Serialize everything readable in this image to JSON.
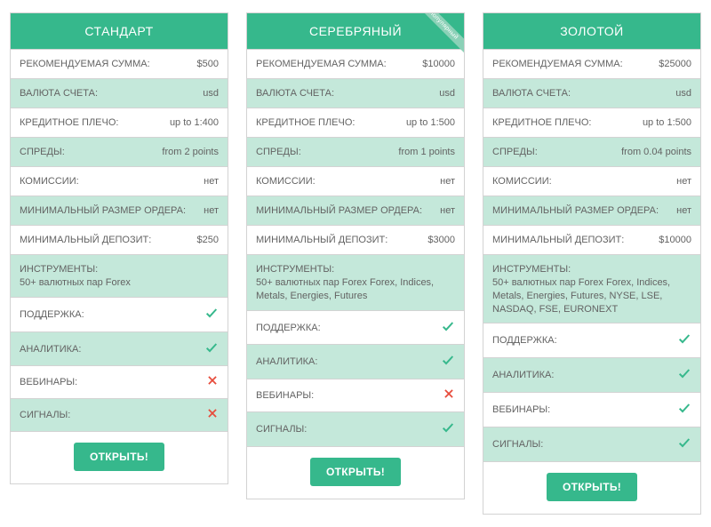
{
  "ribbon_label": "популярный",
  "open_label": "ОТКРЫТЬ!",
  "labels": {
    "amount": "РЕКОМЕНДУЕМАЯ СУММА:",
    "currency": "ВАЛЮТА СЧЕТА:",
    "leverage": "КРЕДИТНОЕ ПЛЕЧО:",
    "spreads": "СПРЕДЫ:",
    "commission": "КОМИССИИ:",
    "min_order": "МИНИМАЛЬНЫЙ РАЗМЕР ОРДЕРА:",
    "min_deposit": "МИНИМАЛЬНЫЙ ДЕПОЗИТ:",
    "instruments": "ИНСТРУМЕНТЫ:",
    "support": "ПОДДЕРЖКА:",
    "analytics": "АНАЛИТИКА:",
    "webinars": "ВЕБИНАРЫ:",
    "signals": "СИГНАЛЫ:"
  },
  "plans": [
    {
      "title": "СТАНДАРТ",
      "popular": false,
      "amount": "$500",
      "currency": "usd",
      "leverage": "up to 1:400",
      "spreads": "from 2 points",
      "commission": "нет",
      "min_order": "нет",
      "min_deposit": "$250",
      "instruments": "50+ валютных пар Forex",
      "support": true,
      "analytics": true,
      "webinars": false,
      "signals": false
    },
    {
      "title": "СЕРЕБРЯНЫЙ",
      "popular": true,
      "amount": "$10000",
      "currency": "usd",
      "leverage": "up to 1:500",
      "spreads": "from 1 points",
      "commission": "нет",
      "min_order": "нет",
      "min_deposit": "$3000",
      "instruments": "50+ валютных пар Forex Forex, Indices, Metals, Energies, Futures",
      "support": true,
      "analytics": true,
      "webinars": false,
      "signals": true
    },
    {
      "title": "ЗОЛОТОЙ",
      "popular": false,
      "amount": "$25000",
      "currency": "usd",
      "leverage": "up to 1:500",
      "spreads": "from 0.04 points",
      "commission": "нет",
      "min_order": "нет",
      "min_deposit": "$10000",
      "instruments": "50+ валютных пар Forex Forex, Indices, Metals, Energies, Futures, NYSE, LSE, NASDAQ, FSE, EURONEXT",
      "support": true,
      "analytics": true,
      "webinars": true,
      "signals": true
    }
  ]
}
